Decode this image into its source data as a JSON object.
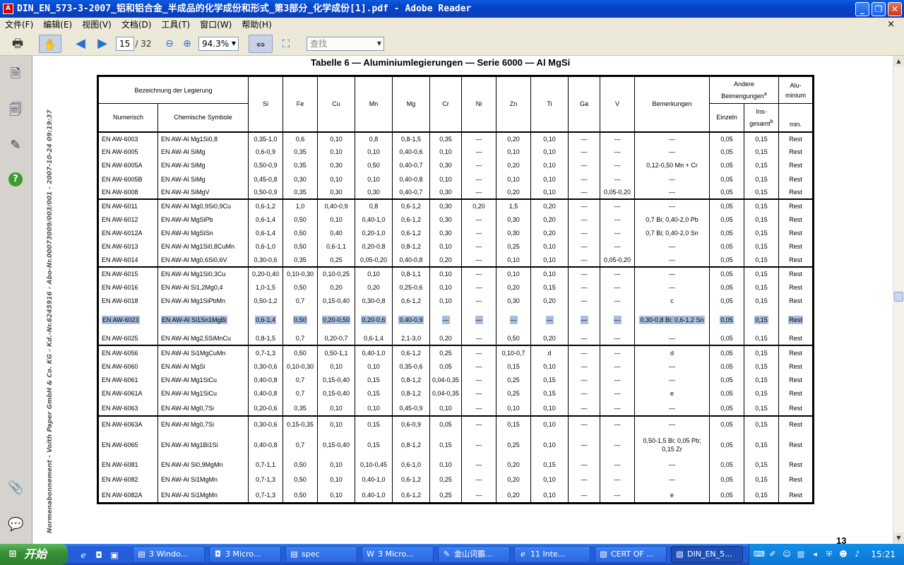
{
  "window": {
    "title": "DIN_EN_573-3-2007_铝和铝合金_半成品的化学成份和形式_第3部分_化学成份[1].pdf - Adobe Reader",
    "min": "_",
    "max": "❐",
    "close": "✕"
  },
  "menu": [
    "文件(F)",
    "编辑(E)",
    "视图(V)",
    "文档(D)",
    "工具(T)",
    "窗口(W)",
    "帮助(H)"
  ],
  "menu_close": "×",
  "toolbar": {
    "page_current": "15",
    "page_total": "/ 32",
    "zoom": "94.3%",
    "search_placeholder": "查找"
  },
  "doc": {
    "table_title": "Tabelle 6 — Aluminiumlegierungen — Serie 6000 — Al MgSi",
    "side_text": "Normenabonnement - Voith Paper GmbH & Co. KG - Kd.-Nr.6245916 - Abo-Nr.00073009/003/001 - 2007-10-24 09:19:37",
    "page_number": "13"
  },
  "table": {
    "h_designation": "Bezeichnung der Legierung",
    "h_numeric": "Numerisch",
    "h_chemical": "Chemische Symbole",
    "elements": [
      "Si",
      "Fe",
      "Cu",
      "Mn",
      "Mg",
      "Cr",
      "Ni",
      "Zn",
      "Ti",
      "Ga",
      "V"
    ],
    "h_remarks": "Bemerkungen",
    "h_other": "Andere Beimengungen",
    "h_other_sup": "a",
    "h_single": "Einzeln",
    "h_total": "Ins-gesamt",
    "h_total_sup": "b",
    "h_al": "Alu-minium",
    "h_min": "min.",
    "rows": [
      [
        "EN AW-6003",
        "EN AW-Al Mg1Si0,8",
        "0,35-1,0",
        "0,6",
        "0,10",
        "0,8",
        "0,8-1,5",
        "0,35",
        "—",
        "0,20",
        "0,10",
        "—",
        "—",
        "—",
        "0,05",
        "0,15",
        "Rest"
      ],
      [
        "EN AW-6005",
        "EN AW-Al SiMg",
        "0,6-0,9",
        "0,35",
        "0,10",
        "0,10",
        "0,40-0,6",
        "0,10",
        "—",
        "0,10",
        "0,10",
        "—",
        "—",
        "—",
        "0,05",
        "0,15",
        "Rest"
      ],
      [
        "EN AW-6005A",
        "EN AW-Al SiMg",
        "0,50-0,9",
        "0,35",
        "0,30",
        "0,50",
        "0,40-0,7",
        "0,30",
        "—",
        "0,20",
        "0,10",
        "—",
        "—",
        "0,12-0,50 Mn + Cr",
        "0,05",
        "0,15",
        "Rest"
      ],
      [
        "EN AW-6005B",
        "EN AW-Al SiMg",
        "0,45-0,8",
        "0,30",
        "0,10",
        "0,10",
        "0,40-0,8",
        "0,10",
        "—",
        "0,10",
        "0,10",
        "—",
        "—",
        "—",
        "0,05",
        "0,15",
        "Rest"
      ],
      [
        "EN AW-6008",
        "EN AW-Al SiMgV",
        "0,50-0,9",
        "0,35",
        "0,30",
        "0,30",
        "0,40-0,7",
        "0,30",
        "—",
        "0,20",
        "0,10",
        "—",
        "0,05-0,20",
        "—",
        "0,05",
        "0,15",
        "Rest"
      ],
      [
        "EN AW-6011",
        "EN AW-Al Mg0,9Si0,9Cu",
        "0,6-1,2",
        "1,0",
        "0,40-0,9",
        "0,8",
        "0,6-1,2",
        "0,30",
        "0,20",
        "1,5",
        "0,20",
        "—",
        "—",
        "—",
        "0,05",
        "0,15",
        "Rest"
      ],
      [
        "EN AW-6012",
        "EN AW-Al MgSiPb",
        "0,6-1,4",
        "0,50",
        "0,10",
        "0,40-1,0",
        "0,6-1,2",
        "0,30",
        "—",
        "0,30",
        "0,20",
        "—",
        "—",
        "0,7 Bi; 0,40-2,0 Pb",
        "0,05",
        "0,15",
        "Rest"
      ],
      [
        "EN AW-6012A",
        "EN AW-Al MgSiSn",
        "0,6-1,4",
        "0,50",
        "0,40",
        "0,20-1,0",
        "0,6-1,2",
        "0,30",
        "—",
        "0,30",
        "0,20",
        "—",
        "—",
        "0,7 Bi; 0,40-2,0 Sn",
        "0,05",
        "0,15",
        "Rest"
      ],
      [
        "EN AW-6013",
        "EN AW-Al Mg1Si0,8CuMn",
        "0,6-1,0",
        "0,50",
        "0,6-1,1",
        "0,20-0,8",
        "0,8-1,2",
        "0,10",
        "—",
        "0,25",
        "0,10",
        "—",
        "—",
        "—",
        "0,05",
        "0,15",
        "Rest"
      ],
      [
        "EN AW-6014",
        "EN AW-Al Mg0,6Si0,6V",
        "0,30-0,6",
        "0,35",
        "0,25",
        "0,05-0,20",
        "0,40-0,8",
        "0,20",
        "—",
        "0,10",
        "0,10",
        "—",
        "0,05-0,20",
        "—",
        "0,05",
        "0,15",
        "Rest"
      ],
      [
        "EN AW-6015",
        "EN AW-Al Mg1Si0,3Cu",
        "0,20-0,40",
        "0,10-0,30",
        "0,10-0,25",
        "0,10",
        "0,8-1,1",
        "0,10",
        "—",
        "0,10",
        "0,10",
        "—",
        "—",
        "—",
        "0,05",
        "0,15",
        "Rest"
      ],
      [
        "EN AW-6016",
        "EN AW-Al Si1,2Mg0,4",
        "1,0-1,5",
        "0,50",
        "0,20",
        "0,20",
        "0,25-0,6",
        "0,10",
        "—",
        "0,20",
        "0,15",
        "—",
        "—",
        "—",
        "0,05",
        "0,15",
        "Rest"
      ],
      [
        "EN AW-6018",
        "EN AW-Al Mg1SiPbMn",
        "0,50-1,2",
        "0,7",
        "0,15-0,40",
        "0,30-0,8",
        "0,6-1,2",
        "0,10",
        "—",
        "0,30",
        "0,20",
        "—",
        "—",
        "c",
        "0,05",
        "0,15",
        "Rest"
      ],
      [
        "EN AW-6023",
        "EN AW-Al Si1Sn1MgBi",
        "0,6-1,4",
        "0,50",
        "0,20-0,50",
        "0,20-0,6",
        "0,40-0,9",
        "—",
        "—",
        "—",
        "—",
        "—",
        "—",
        "0,30-0,8 Bi; 0,6-1,2 Sn",
        "0,05",
        "0,15",
        "Rest"
      ],
      [
        "EN AW-6025",
        "EN AW-Al Mg2,5SiMnCu",
        "0,8-1,5",
        "0,7",
        "0,20-0,7",
        "0,6-1,4",
        "2,1-3,0",
        "0,20",
        "—",
        "0,50",
        "0,20",
        "—",
        "—",
        "—",
        "0,05",
        "0,15",
        "Rest"
      ],
      [
        "EN AW-6056",
        "EN AW-Al Si1MgCuMn",
        "0,7-1,3",
        "0,50",
        "0,50-1,1",
        "0,40-1,0",
        "0,6-1,2",
        "0,25",
        "—",
        "0,10-0,7",
        "d",
        "—",
        "—",
        "d",
        "0,05",
        "0,15",
        "Rest"
      ],
      [
        "EN AW-6060",
        "EN AW-Al MgSi",
        "0,30-0,6",
        "0,10-0,30",
        "0,10",
        "0,10",
        "0,35-0,6",
        "0,05",
        "—",
        "0,15",
        "0,10",
        "—",
        "—",
        "—",
        "0,05",
        "0,15",
        "Rest"
      ],
      [
        "EN AW-6061",
        "EN AW-Al Mg1SiCu",
        "0,40-0,8",
        "0,7",
        "0,15-0,40",
        "0,15",
        "0,8-1,2",
        "0,04-0,35",
        "—",
        "0,25",
        "0,15",
        "—",
        "—",
        "—",
        "0,05",
        "0,15",
        "Rest"
      ],
      [
        "EN AW-6061A",
        "EN AW-Al Mg1SiCu",
        "0,40-0,8",
        "0,7",
        "0,15-0,40",
        "0,15",
        "0,8-1,2",
        "0,04-0,35",
        "—",
        "0,25",
        "0,15",
        "—",
        "—",
        "e",
        "0,05",
        "0,15",
        "Rest"
      ],
      [
        "EN AW-6063",
        "EN AW-Al Mg0,7Si",
        "0,20-0,6",
        "0,35",
        "0,10",
        "0,10",
        "0,45-0,9",
        "0,10",
        "—",
        "0,10",
        "0,10",
        "—",
        "—",
        "—",
        "0,05",
        "0,15",
        "Rest"
      ],
      [
        "EN AW-6063A",
        "EN AW-Al Mg0,7Si",
        "0,30-0,6",
        "0,15-0,35",
        "0,10",
        "0,15",
        "0,6-0,9",
        "0,05",
        "—",
        "0,15",
        "0,10",
        "—",
        "—",
        "—",
        "0,05",
        "0,15",
        "Rest"
      ],
      [
        "EN AW-6065",
        "EN AW-Al Mg1Bi1Si",
        "0,40-0,8",
        "0,7",
        "0,15-0,40",
        "0,15",
        "0,8-1,2",
        "0,15",
        "—",
        "0,25",
        "0,10",
        "—",
        "—",
        "0,50-1,5 Bi; 0,05 Pb; 0,15 Zr",
        "0,05",
        "0,15",
        "Rest"
      ],
      [
        "EN AW-6081",
        "EN AW-Al Si0,9MgMn",
        "0,7-1,1",
        "0,50",
        "0,10",
        "0,10-0,45",
        "0,6-1,0",
        "0,10",
        "—",
        "0,20",
        "0,15",
        "—",
        "—",
        "—",
        "0,05",
        "0,15",
        "Rest"
      ],
      [
        "EN AW-6082",
        "EN AW-Al Si1MgMn",
        "0,7-1,3",
        "0,50",
        "0,10",
        "0,40-1,0",
        "0,6-1,2",
        "0,25",
        "—",
        "0,20",
        "0,10",
        "—",
        "—",
        "—",
        "0,05",
        "0,15",
        "Rest"
      ],
      [
        "EN AW-6082A",
        "EN AW-Al Si1MgMn",
        "0,7-1,3",
        "0,50",
        "0,10",
        "0,40-1,0",
        "0,6-1,2",
        "0,25",
        "—",
        "0,20",
        "0,10",
        "—",
        "—",
        "e",
        "0,05",
        "0,15",
        "Rest"
      ]
    ]
  },
  "taskbar": {
    "start": "开始",
    "buttons": [
      "3 Windo...",
      "3 Micro...",
      "spec",
      "3 Micro...",
      "金山词霸...",
      "11 Inte...",
      "CERT OF ...",
      "DIN_EN_5..."
    ],
    "clock": "15:21"
  }
}
